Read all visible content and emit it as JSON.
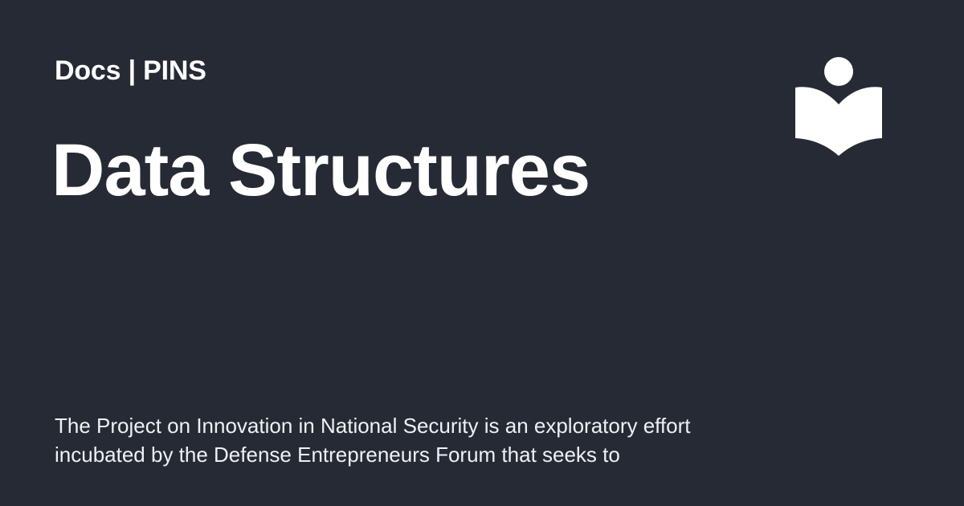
{
  "header": {
    "site_label": "Docs | PINS"
  },
  "page": {
    "title": "Data Structures",
    "description": "The Project on Innovation in National Security is an exploratory effort incubated by the Defense Entrepreneurs Forum that seeks to"
  },
  "logo": {
    "icon": "reader-book-icon"
  },
  "colors": {
    "background": "#262a35",
    "text": "#ffffff"
  }
}
